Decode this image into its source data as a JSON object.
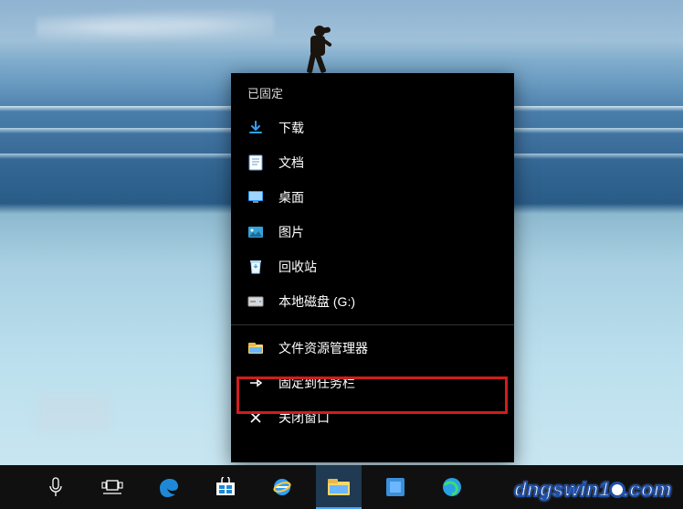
{
  "jumplist": {
    "section_pinned": "已固定",
    "pinned_items": [
      {
        "name": "downloads",
        "icon": "download-arrow",
        "label": "下载"
      },
      {
        "name": "documents",
        "icon": "document",
        "label": "文档"
      },
      {
        "name": "desktop",
        "icon": "desktop",
        "label": "桌面"
      },
      {
        "name": "pictures",
        "icon": "pictures",
        "label": "图片"
      },
      {
        "name": "recycle",
        "icon": "recycle-bin",
        "label": "回收站"
      },
      {
        "name": "drive-g",
        "icon": "drive",
        "label": "本地磁盘 (G:)"
      }
    ],
    "app_item": {
      "name": "file-explorer",
      "icon": "explorer",
      "label": "文件资源管理器"
    },
    "actions": [
      {
        "name": "pin-to-taskbar",
        "icon": "pin",
        "label": "固定到任务栏"
      },
      {
        "name": "close-window",
        "icon": "close",
        "label": "关闭窗口"
      }
    ]
  },
  "taskbar": {
    "items": [
      {
        "name": "cortana",
        "icon": "mic"
      },
      {
        "name": "task-view",
        "icon": "taskview"
      },
      {
        "name": "edge",
        "icon": "edge"
      },
      {
        "name": "store",
        "icon": "store"
      },
      {
        "name": "ie",
        "icon": "ie"
      },
      {
        "name": "explorer",
        "icon": "explorer",
        "active": true
      },
      {
        "name": "app-blue",
        "icon": "bluesquare"
      },
      {
        "name": "browser-360",
        "icon": "ball360"
      }
    ]
  },
  "watermark": {
    "text_left": "dngswin1",
    "text_right": ".com"
  }
}
